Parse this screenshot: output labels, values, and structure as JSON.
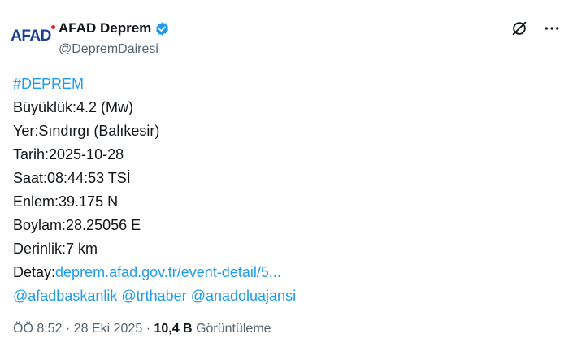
{
  "account": {
    "avatar_logo": "AFAD",
    "display_name": "AFAD Deprem",
    "handle": "@DepremDairesi",
    "brand_color": "#1c3f94",
    "brand_accent": "#e3211b",
    "verified_color": "#1d9bf0",
    "verified_icon": "verified-badge-icon"
  },
  "actions": {
    "grok_icon": "grok-icon",
    "more_icon": "more-dots-icon"
  },
  "tweet": {
    "hashtag": "#DEPREM",
    "lines": [
      "Büyüklük:4.2 (Mw)",
      "Yer:Sındırgı (Balıkesir)",
      "Tarih:2025-10-28",
      "Saat:08:44:53 TSİ",
      "Enlem:39.175 N",
      "Boylam:28.25056 E",
      "Derinlik:7 km"
    ],
    "detail_label": "Detay:",
    "detail_link": "deprem.afad.gov.tr/event-detail/5...",
    "mentions": [
      "@afadbaskanlik",
      "@trthaber",
      "@anadoluajansi"
    ],
    "link_color": "#1d9bf0"
  },
  "meta": {
    "time": "ÖÖ 8:52",
    "separator": "·",
    "date": "28 Eki 2025",
    "views_count": "10,4 B",
    "views_label": "Görüntüleme"
  }
}
